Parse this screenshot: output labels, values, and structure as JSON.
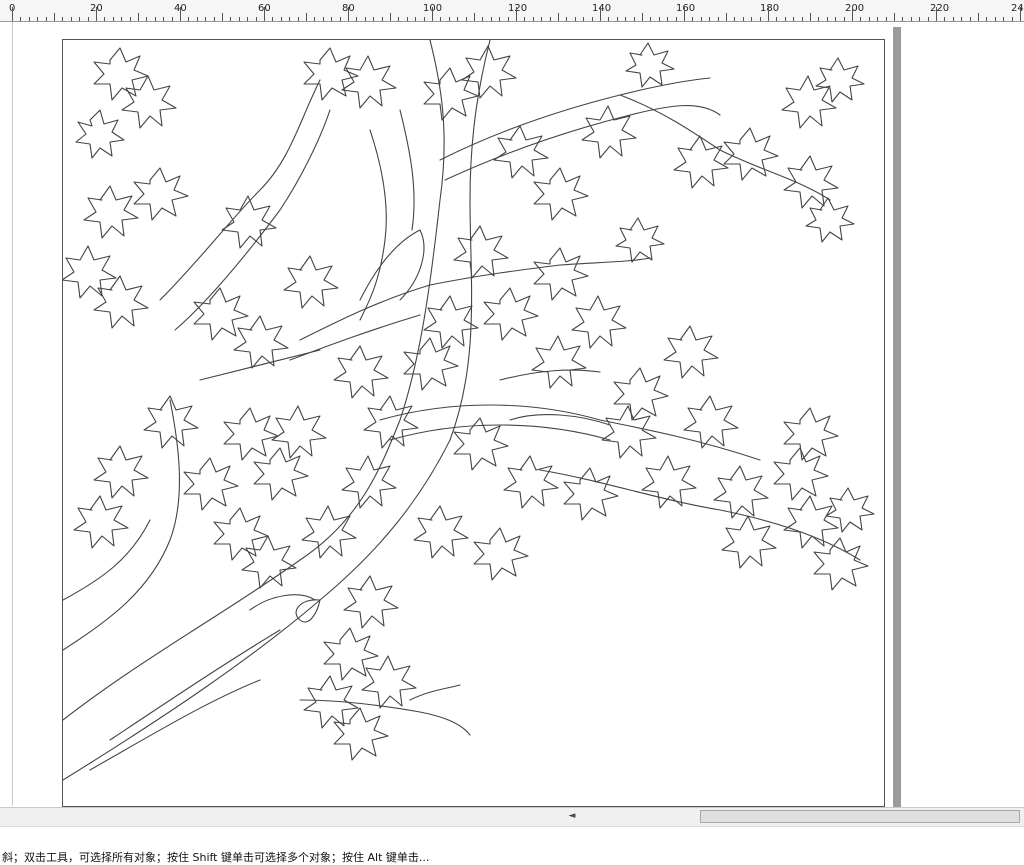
{
  "ruler": {
    "labels": [
      "0",
      "20",
      "40",
      "60",
      "80",
      "100",
      "120",
      "140",
      "160",
      "180",
      "200",
      "220",
      "24"
    ]
  },
  "status": {
    "hint": "斜；双击工具，可选择所有对象；按住 Shift 键单击可选择多个对象；按住 Alt 键单击..."
  },
  "scroll": {
    "left_arrow": "◄",
    "right_arrow": "►"
  },
  "colors": {
    "line": "#444444",
    "page_border": "#555555",
    "shadow": "#9b9b9b"
  }
}
